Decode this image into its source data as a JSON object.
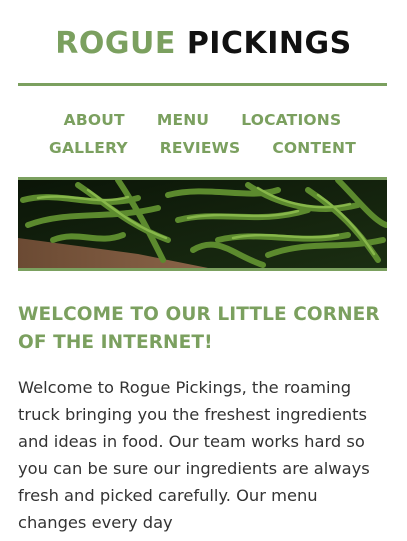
{
  "site": {
    "logo_part1": "ROGUE",
    "logo_part2": "PICKINGS"
  },
  "nav": {
    "row1": [
      "ABOUT",
      "MENU",
      "LOCATIONS"
    ],
    "row2": [
      "GALLERY",
      "REVIEWS",
      "CONTENT"
    ]
  },
  "hero": {
    "image_subject": "green beans on wooden board"
  },
  "main": {
    "heading": "WELCOME TO OUR LITTLE CORNER OF THE INTERNET!",
    "intro": "Welcome to Rogue Pickings, the roaming truck bringing you the freshest ingredients and ideas in food. Our team works hard so you can be sure our ingredients are always fresh and picked carefully. Our menu changes every day"
  },
  "colors": {
    "accent": "#7ba05f",
    "text": "#333333",
    "logo_dark": "#111111"
  }
}
